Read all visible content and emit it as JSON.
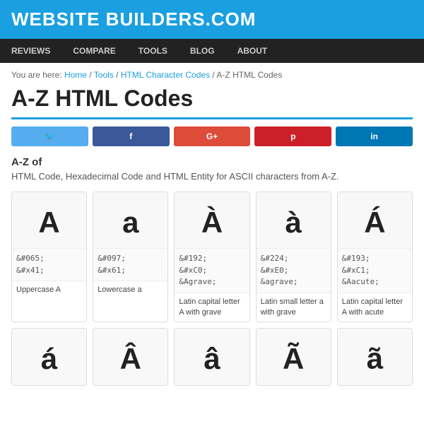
{
  "header": {
    "site_title": "WEBSITE BUILDERS.COM",
    "background_color": "#1a9fe0"
  },
  "nav": {
    "items": [
      {
        "label": "REVIEWS",
        "href": "#"
      },
      {
        "label": "COMPARE",
        "href": "#"
      },
      {
        "label": "TOOLS",
        "href": "#"
      },
      {
        "label": "BLOG",
        "href": "#"
      },
      {
        "label": "ABOUT",
        "href": "#"
      }
    ]
  },
  "breadcrumb": {
    "prefix": "You are here:",
    "items": [
      {
        "label": "Home",
        "href": "#"
      },
      {
        "label": "Tools",
        "href": "#"
      },
      {
        "label": "HTML Character Codes",
        "href": "#"
      },
      {
        "label": "A-Z HTML Codes",
        "href": "#"
      }
    ]
  },
  "page": {
    "title": "A-Z HTML Codes",
    "section_title": "A-Z of",
    "description": "HTML Code, Hexadecimal Code and HTML Entity for ASCII characters from A-Z."
  },
  "social": {
    "buttons": [
      {
        "platform": "twitter",
        "label": "t",
        "color": "#55acee"
      },
      {
        "platform": "facebook",
        "label": "f",
        "color": "#3b5998"
      },
      {
        "platform": "google",
        "label": "G+",
        "color": "#dd4b39"
      },
      {
        "platform": "pinterest",
        "label": "p",
        "color": "#cb2027"
      },
      {
        "platform": "linkedin",
        "label": "in",
        "color": "#0077b5"
      }
    ]
  },
  "characters": [
    {
      "glyph": "A",
      "codes": [
        "&#065;",
        "&#x41;"
      ],
      "entity": "",
      "label": "Uppercase A"
    },
    {
      "glyph": "a",
      "codes": [
        "&#097;",
        "&#x61;"
      ],
      "entity": "",
      "label": "Lowercase a"
    },
    {
      "glyph": "À",
      "codes": [
        "&#192;",
        "&#xC0;"
      ],
      "entity": "&Agrave;",
      "label": "Latin capital letter A with grave"
    },
    {
      "glyph": "à",
      "codes": [
        "&#224;",
        "&#xE0;"
      ],
      "entity": "&agrave;",
      "label": "Latin small letter a with grave"
    },
    {
      "glyph": "Á",
      "codes": [
        "&#193;",
        "&#xC1;"
      ],
      "entity": "&Aacute;",
      "label": "Latin capital letter A with acute"
    }
  ],
  "characters_row2": [
    {
      "glyph": "á"
    },
    {
      "glyph": "Â"
    },
    {
      "glyph": "â"
    },
    {
      "glyph": "Ã"
    },
    {
      "glyph": "ã"
    }
  ]
}
